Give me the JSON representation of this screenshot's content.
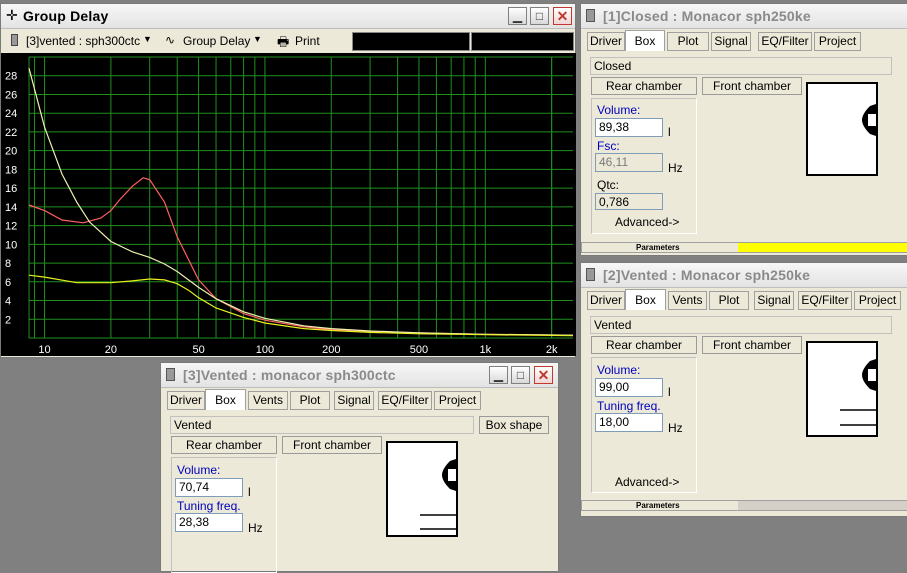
{
  "group_delay_window": {
    "title": "Group Delay",
    "toolbar": {
      "driver_select": "[3]vented : sph300ctc",
      "mode_select": "Group Delay",
      "print_label": "Print"
    },
    "y_ticks": [
      "28",
      "26",
      "24",
      "22",
      "20",
      "18",
      "16",
      "14",
      "12",
      "10",
      "8",
      "6",
      "4",
      "2"
    ],
    "x_ticks": [
      "10",
      "20",
      "50",
      "100",
      "200",
      "500",
      "1k",
      "2k"
    ]
  },
  "chart_data": {
    "type": "line",
    "title": "",
    "xlabel": "",
    "ylabel": "",
    "x_scale": "log",
    "xlim": [
      8.5,
      2500
    ],
    "ylim": [
      0,
      30
    ],
    "grid": true,
    "series": [
      {
        "color": "#ff6060",
        "x": [
          8.5,
          10,
          12,
          15,
          18,
          20,
          22,
          25,
          28,
          30,
          35,
          40,
          50,
          60,
          80,
          100,
          150,
          200,
          300,
          500,
          1000,
          2500
        ],
        "y": [
          14.2,
          13.6,
          12.6,
          12.3,
          12.8,
          13.6,
          14.8,
          16.2,
          17.1,
          16.9,
          14.5,
          10.8,
          6.2,
          4.2,
          2.6,
          1.9,
          1.2,
          0.9,
          0.7,
          0.55,
          0.4,
          0.3
        ]
      },
      {
        "color": "#f0f0b0",
        "x": [
          8.5,
          10,
          12,
          14,
          16,
          20,
          25,
          30,
          35,
          40,
          50,
          60,
          80,
          100,
          150,
          200,
          300,
          500,
          1000,
          2500
        ],
        "y": [
          28.8,
          22.5,
          17.5,
          14.5,
          12.4,
          10.3,
          9.2,
          8.6,
          7.9,
          7.1,
          5.4,
          4.2,
          2.8,
          2.1,
          1.3,
          1.0,
          0.75,
          0.55,
          0.4,
          0.3
        ]
      },
      {
        "color": "#e8f020",
        "x": [
          8.5,
          10,
          14,
          20,
          25,
          30,
          35,
          40,
          45,
          50,
          60,
          80,
          100,
          150,
          200,
          300,
          500,
          1000,
          2500
        ],
        "y": [
          6.7,
          6.5,
          5.9,
          5.9,
          6.1,
          6.3,
          6.2,
          5.8,
          5.1,
          4.3,
          3.2,
          2.2,
          1.6,
          1.0,
          0.8,
          0.6,
          0.45,
          0.35,
          0.25
        ]
      }
    ]
  },
  "closed_window": {
    "title": "[1]Closed : Monacor sph250ke",
    "tabs": [
      "Driver",
      "Box",
      "Plot",
      "Signal",
      "EQ/Filter",
      "Project"
    ],
    "box_type": "Closed",
    "rear_chamber": "Rear chamber",
    "front_chamber": "Front chamber",
    "volume_label": "Volume:",
    "volume_value": "89,38",
    "volume_unit": "l",
    "fsc_label": "Fsc:",
    "fsc_value": "46,11",
    "fsc_unit": "Hz",
    "qtc_label": "Qtc:",
    "qtc_value": "0,786",
    "advanced": "Advanced->",
    "parameters": "Parameters",
    "accent": "#ffff00"
  },
  "vented2_window": {
    "title": "[2]Vented : Monacor sph250ke",
    "tabs": [
      "Driver",
      "Box",
      "Vents",
      "Plot",
      "Signal",
      "EQ/Filter",
      "Project"
    ],
    "box_type": "Vented",
    "rear_chamber": "Rear chamber",
    "front_chamber": "Front chamber",
    "volume_label": "Volume:",
    "volume_value": "99,00",
    "volume_unit": "l",
    "tuning_label": "Tuning freq.",
    "tuning_value": "18,00",
    "tuning_unit": "Hz",
    "advanced": "Advanced->",
    "parameters": "Parameters"
  },
  "vented3_window": {
    "title": "[3]Vented : monacor sph300ctc",
    "tabs": [
      "Driver",
      "Box",
      "Vents",
      "Plot",
      "Signal",
      "EQ/Filter",
      "Project"
    ],
    "box_type": "Vented",
    "box_shape": "Box shape",
    "rear_chamber": "Rear chamber",
    "front_chamber": "Front chamber",
    "volume_label": "Volume:",
    "volume_value": "70,74",
    "volume_unit": "l",
    "tuning_label": "Tuning freq.",
    "tuning_value": "28,38",
    "tuning_unit": "Hz"
  }
}
